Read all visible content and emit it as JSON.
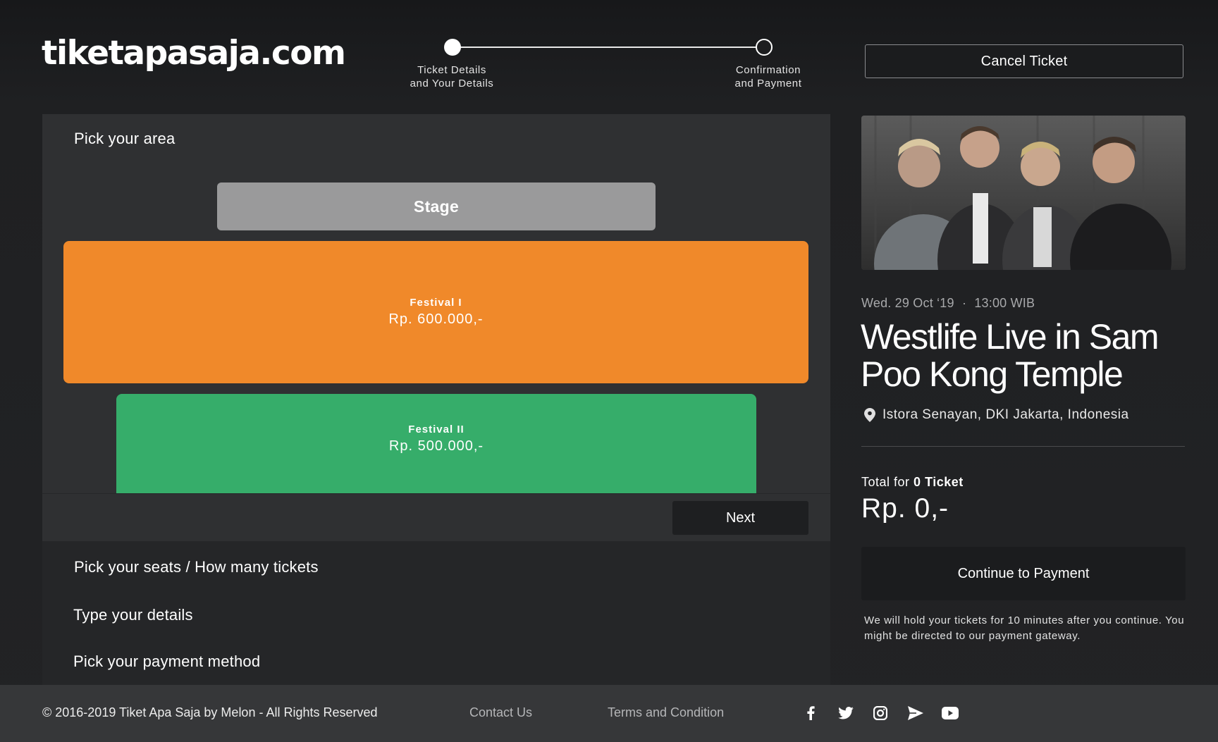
{
  "header": {
    "logo_text": "tiketapasaja.com",
    "steps": [
      {
        "line1": "Ticket Details",
        "line2": "and Your Details",
        "state": "active"
      },
      {
        "line1": "Confirmation",
        "line2": "and Payment",
        "state": "pending"
      }
    ],
    "cancel_label": "Cancel Ticket"
  },
  "area_picker": {
    "title": "Pick your area",
    "stage_label": "Stage",
    "zones": [
      {
        "name": "Festival I",
        "price": "Rp. 600.000,-",
        "color": "#f0892a"
      },
      {
        "name": "Festival II",
        "price": "Rp. 500.000,-",
        "color": "#36ad6a"
      }
    ],
    "next_label": "Next"
  },
  "steps_collapsed": {
    "seats": "Pick your seats / How many tickets",
    "details": "Type your details",
    "payment": "Pick your payment method"
  },
  "event": {
    "date": "Wed. 29 Oct ‘19",
    "separator": "·",
    "time": "13:00 WIB",
    "title": "Westlife Live in Sam Poo Kong Temple",
    "location": "Istora Senayan, DKI Jakarta, Indonesia",
    "photo_icon": "band-photo"
  },
  "summary": {
    "total_prefix": "Total for",
    "ticket_count": "0",
    "ticket_word": "Ticket",
    "total_value": "Rp. 0,-",
    "continue_label": "Continue to Payment",
    "note": "We will hold your tickets for 10 minutes after you continue. You might be directed to our payment gateway."
  },
  "footer": {
    "copyright": "© 2016-2019 Tiket Apa Saja by Melon - All Rights Reserved",
    "contact": "Contact Us",
    "terms": "Terms and Condition",
    "social": [
      "facebook-icon",
      "twitter-icon",
      "instagram-icon",
      "send-icon",
      "youtube-icon"
    ]
  },
  "colors": {
    "background": "#1f2022",
    "panel": "#2f3032",
    "festival_1": "#f0892a",
    "festival_2": "#36ad6a",
    "stage": "#9a9a9b"
  }
}
